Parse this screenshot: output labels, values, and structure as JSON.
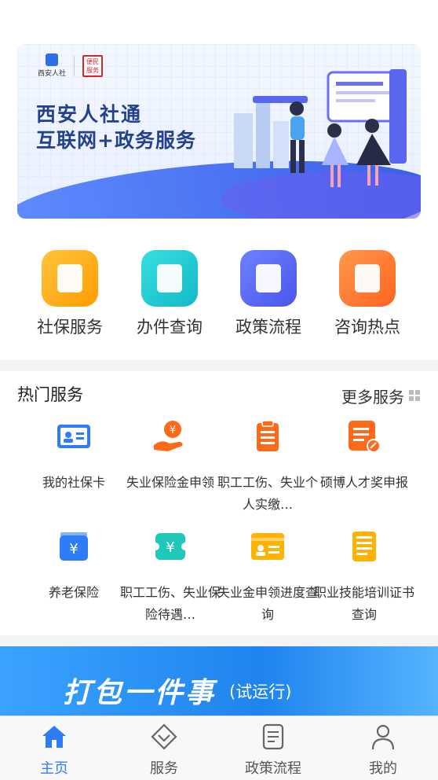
{
  "banner": {
    "logo_text": "西安人社",
    "seal_text": "便民服务",
    "title_line1": "西安人社通",
    "title_line2": "互联网+政务服务"
  },
  "quick_actions": [
    {
      "label": "社保服务",
      "icon": "document-search-icon",
      "color": "#ffb300"
    },
    {
      "label": "办件查询",
      "icon": "book-icon",
      "color": "#1fc8cf"
    },
    {
      "label": "政策流程",
      "icon": "bookmark-icon",
      "color": "#5b6ff6"
    },
    {
      "label": "咨询热点",
      "icon": "heart-card-icon",
      "color": "#ff7a30"
    }
  ],
  "hot_services": {
    "title": "热门服务",
    "more_label": "更多服务",
    "items": [
      {
        "label": "我的社保卡",
        "icon": "id-card-icon",
        "color": "#2f7df6"
      },
      {
        "label": "失业保险金申领",
        "icon": "yuan-hand-icon",
        "color": "#ff6a1a"
      },
      {
        "label": "职工工伤、失业个人实缴…",
        "icon": "clipboard-icon",
        "color": "#ff6a1a"
      },
      {
        "label": "硕博人才奖申报",
        "icon": "edit-document-icon",
        "color": "#ff6a1a"
      },
      {
        "label": "养老保险",
        "icon": "yuan-box-icon",
        "color": "#2f7df6"
      },
      {
        "label": "职工工伤、失业保险待遇…",
        "icon": "yuan-ticket-icon",
        "color": "#1fc8b8"
      },
      {
        "label": "失业金申领进度查询",
        "icon": "card-icon",
        "color": "#ffb300"
      },
      {
        "label": "职业技能培训证书查询",
        "icon": "certificate-icon",
        "color": "#ffb300"
      }
    ]
  },
  "promo": {
    "big_text": "打包一件事",
    "small_text": "(试运行)"
  },
  "tabbar": [
    {
      "label": "主页",
      "icon": "home-icon",
      "active": true
    },
    {
      "label": "服务",
      "icon": "diamond-icon",
      "active": false
    },
    {
      "label": "政策流程",
      "icon": "document-icon",
      "active": false
    },
    {
      "label": "我的",
      "icon": "user-icon",
      "active": false
    }
  ],
  "colors": {
    "accent": "#2f7df6",
    "banner_title": "#24418e"
  }
}
